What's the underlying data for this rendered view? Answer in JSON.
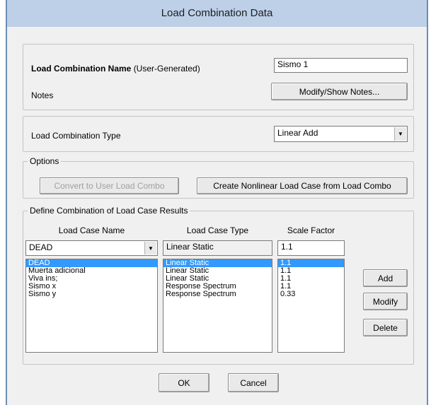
{
  "window": {
    "title": "Load Combination Data"
  },
  "name_section": {
    "name_label": "Load Combination Name",
    "name_hint": "(User-Generated)",
    "name_value": "Sismo 1",
    "notes_label": "Notes",
    "notes_button": "Modify/Show Notes..."
  },
  "type_section": {
    "type_label": "Load Combination Type",
    "type_value": "Linear Add"
  },
  "options": {
    "legend": "Options",
    "convert_button": "Convert to User Load Combo",
    "create_button": "Create Nonlinear Load Case from Load Combo"
  },
  "define": {
    "legend": "Define Combination of Load Case Results",
    "headers": {
      "name": "Load Case Name",
      "type": "Load Case Type",
      "factor": "Scale Factor"
    },
    "edit_row": {
      "name": "DEAD",
      "type": "Linear Static",
      "factor": "1.1"
    },
    "rows": [
      {
        "name": "DEAD",
        "type": "Linear Static",
        "factor": "1.1"
      },
      {
        "name": "Muerta adicional",
        "type": "Linear Static",
        "factor": "1.1"
      },
      {
        "name": "Viva ins;",
        "type": "Linear Static",
        "factor": "1.1"
      },
      {
        "name": "Sismo x",
        "type": "Response Spectrum",
        "factor": "1.1"
      },
      {
        "name": "Sismo y",
        "type": "Response Spectrum",
        "factor": "0.33"
      }
    ],
    "add_button": "Add",
    "modify_button": "Modify",
    "delete_button": "Delete"
  },
  "footer": {
    "ok_button": "OK",
    "cancel_button": "Cancel"
  }
}
